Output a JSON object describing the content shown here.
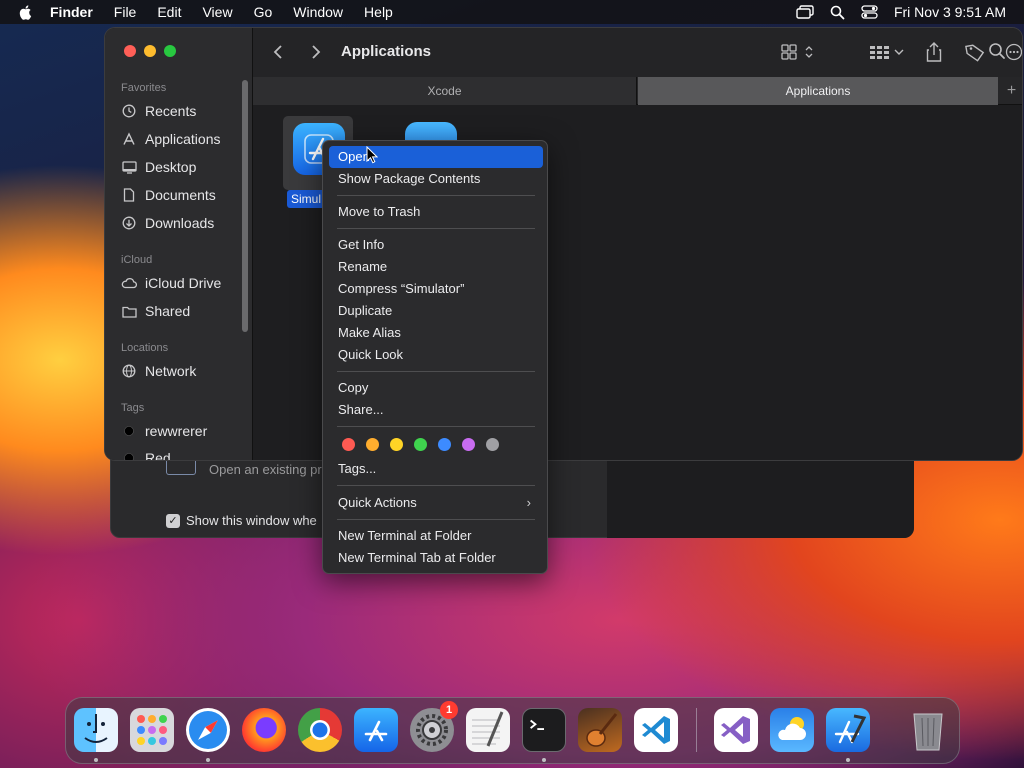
{
  "menubar": {
    "items": [
      "Finder",
      "File",
      "Edit",
      "View",
      "Go",
      "Window",
      "Help"
    ],
    "clock": "Fri Nov 3  9:51 AM"
  },
  "finder": {
    "title": "Applications",
    "sidebar": {
      "favorites_header": "Favorites",
      "favorites": [
        "Recents",
        "Applications",
        "Desktop",
        "Documents",
        "Downloads"
      ],
      "icloud_header": "iCloud",
      "icloud": [
        "iCloud Drive",
        "Shared"
      ],
      "locations_header": "Locations",
      "locations": [
        "Network"
      ],
      "tags_header": "Tags",
      "tags": [
        "rewwrerer",
        "Red"
      ]
    },
    "tabs": [
      "Xcode",
      "Applications"
    ],
    "tab_plus": "+",
    "selected_file_label": "Simul"
  },
  "behind_window": {
    "open_text": "Open an existing pro",
    "show_text": "Show this window whe",
    "checkbox_mark": "✓"
  },
  "context_menu": {
    "items": {
      "open": "Open",
      "show_package": "Show Package Contents",
      "move_trash": "Move to Trash",
      "get_info": "Get Info",
      "rename": "Rename",
      "compress": "Compress “Simulator”",
      "duplicate": "Duplicate",
      "make_alias": "Make Alias",
      "quick_look": "Quick Look",
      "copy": "Copy",
      "share": "Share...",
      "tags": "Tags...",
      "quick_actions": "Quick Actions",
      "new_terminal": "New Terminal at Folder",
      "new_terminal_tab": "New Terminal Tab at Folder"
    },
    "submenu_arrow": "›",
    "tag_colors": [
      "#ff5a52",
      "#ffad2e",
      "#ffd426",
      "#3fd34e",
      "#3d8bff",
      "#c86cf0",
      "#a0a0a4"
    ]
  },
  "dock": {
    "apps": [
      "finder-icon",
      "launchpad-icon",
      "safari-icon",
      "firefox-icon",
      "chrome-icon",
      "app-store-icon",
      "system-settings-icon",
      "textedit-icon",
      "terminal-icon",
      "garageband-icon",
      "vscode-icon",
      "visual-studio-icon",
      "weather-icon",
      "xcode-icon",
      "trash-icon"
    ],
    "settings_badge": "1"
  },
  "colors": {
    "menu_highlight": "#1a60d8",
    "selection_label": "#1a5ad6"
  }
}
